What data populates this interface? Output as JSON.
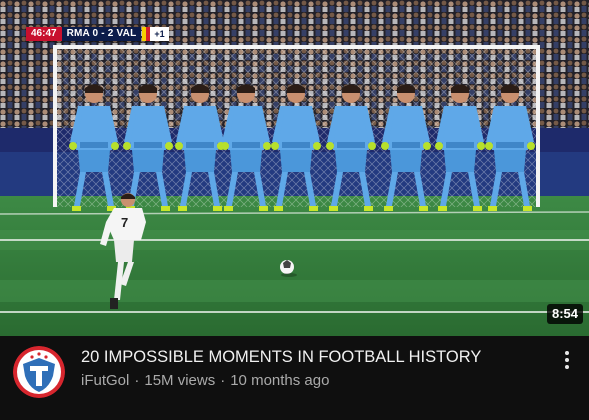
{
  "video": {
    "title": "20 IMPOSSIBLE MOMENTS IN FOOTBALL HISTORY",
    "channel": "iFutGol",
    "views": "15M views",
    "age": "10 months ago",
    "duration": "8:54",
    "separator": "·"
  },
  "thumbnail": {
    "scorebug": {
      "clock": "46:47",
      "score": "RMA 0 - 2 VAL",
      "extra": "+1"
    },
    "player_number": "7",
    "wall_players": 9
  },
  "icons": {
    "channel_avatar": "shield-logo-icon",
    "more_menu": "vertical-dots-icon"
  },
  "colors": {
    "background": "#0f0f0f",
    "title_text": "#f1f1f1",
    "meta_text": "#aaaaaa",
    "keeper_kit": "#5fa8e8",
    "pitch": "#2f7d3a",
    "avatar_red": "#d7262e",
    "avatar_blue": "#2f6fb8"
  }
}
